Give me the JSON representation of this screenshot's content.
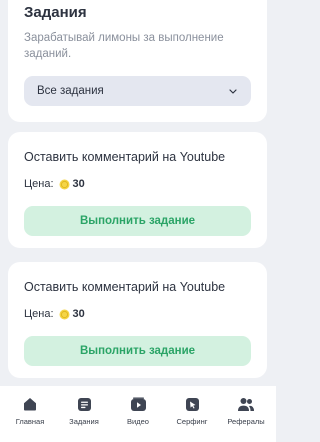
{
  "header": {
    "title": "Задания",
    "subtitle": "Зарабатывай лимоны за выполнение заданий."
  },
  "filter": {
    "selected": "Все задания",
    "icon": "chevron-down-icon"
  },
  "tasks": [
    {
      "title": "Оставить комментарий на Youtube",
      "price_label": "Цена:",
      "price_value": "30",
      "price_icon": "lemon-coin-icon",
      "button_label": "Выполнить задание"
    },
    {
      "title": "Оставить комментарий на Youtube",
      "price_label": "Цена:",
      "price_value": "30",
      "price_icon": "lemon-coin-icon",
      "button_label": "Выполнить задание"
    }
  ],
  "nav": {
    "items": [
      {
        "label": "Главная",
        "icon": "home-icon",
        "active": false
      },
      {
        "label": "Задания",
        "icon": "tasks-icon",
        "active": true
      },
      {
        "label": "Видео",
        "icon": "video-icon",
        "active": false
      },
      {
        "label": "Серфинг",
        "icon": "surfing-icon",
        "active": false
      },
      {
        "label": "Рефералы",
        "icon": "referrals-icon",
        "active": false
      }
    ]
  },
  "colors": {
    "background": "#eef0f4",
    "card": "#ffffff",
    "select_bg": "#e4e7f0",
    "button_bg": "#d3f1e0",
    "button_text": "#2aa466",
    "coin": "#f5d547",
    "icon": "#3f4553"
  }
}
